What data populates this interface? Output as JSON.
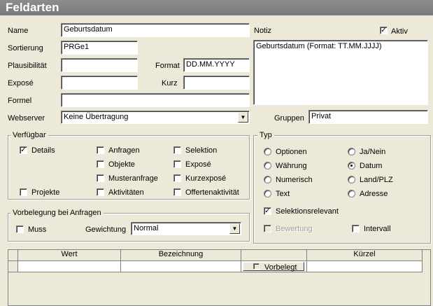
{
  "window": {
    "title": "Feldarten"
  },
  "form": {
    "name_label": "Name",
    "name_value": "Geburtsdatum",
    "sortierung_label": "Sortierung",
    "sortierung_value": "PRGe1",
    "plausibilitaet_label": "Plausibilität",
    "plausibilitaet_value": "",
    "format_label": "Format",
    "format_value": "DD.MM.YYYY",
    "expose_label": "Exposé",
    "expose_value": "",
    "kurz_label": "Kurz",
    "kurz_value": "",
    "formel_label": "Formel",
    "formel_value": "",
    "webserver_label": "Webserver",
    "webserver_value": "Keine Übertragung",
    "notiz_label": "Notiz",
    "notiz_value": "Geburtsdatum (Format: TT.MM.JJJJ)",
    "aktiv_label": "Aktiv",
    "aktiv_checked": true,
    "gruppen_label": "Gruppen",
    "gruppen_value": "Privat"
  },
  "verfuegbar": {
    "title": "Verfügbar",
    "items": [
      {
        "label": "Details",
        "checked": true
      },
      {
        "label": "Projekte",
        "checked": false
      },
      {
        "label": "Anfragen",
        "checked": false
      },
      {
        "label": "Objekte",
        "checked": false
      },
      {
        "label": "Musteranfrage",
        "checked": false
      },
      {
        "label": "Aktivitäten",
        "checked": false
      },
      {
        "label": "Selektion",
        "checked": false
      },
      {
        "label": "Exposé",
        "checked": false
      },
      {
        "label": "Kurzexposé",
        "checked": false
      },
      {
        "label": "Offertenaktivität",
        "checked": false
      }
    ]
  },
  "vorbelegung": {
    "title": "Vorbelegung bei Anfragen",
    "muss_label": "Muss",
    "muss_checked": false,
    "gewichtung_label": "Gewichtung",
    "gewichtung_value": "Normal"
  },
  "typ": {
    "title": "Typ",
    "options": [
      {
        "label": "Optionen",
        "selected": false
      },
      {
        "label": "Währung",
        "selected": false
      },
      {
        "label": "Numerisch",
        "selected": false
      },
      {
        "label": "Text",
        "selected": false
      },
      {
        "label": "Ja/Nein",
        "selected": false
      },
      {
        "label": "Datum",
        "selected": true
      },
      {
        "label": "Land/PLZ",
        "selected": false
      },
      {
        "label": "Adresse",
        "selected": false
      }
    ],
    "selektionsrelevant_label": "Selektionsrelevant",
    "selektionsrelevant_checked": true,
    "bewertung_label": "Bewertung",
    "bewertung_checked": false,
    "intervall_label": "Intervall",
    "intervall_checked": false
  },
  "grid": {
    "columns": [
      "Wert",
      "Bezeichnung",
      "",
      "Kürzel"
    ],
    "vorbelegt_label": "Vorbelegt"
  }
}
